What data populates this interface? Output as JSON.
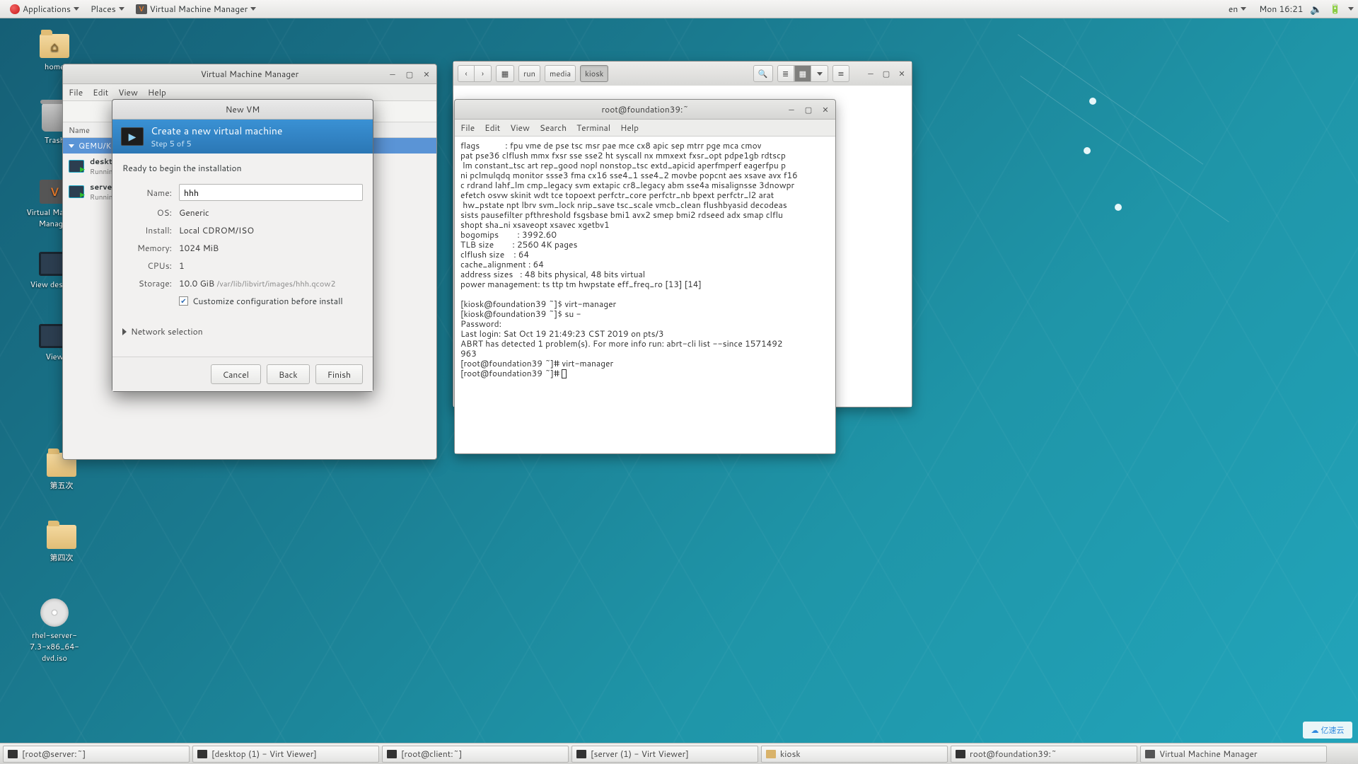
{
  "panel": {
    "applications": "Applications",
    "places": "Places",
    "app_title": "Virtual Machine Manager",
    "lang": "en",
    "clock": "Mon 16:21"
  },
  "desktop_icons": {
    "home": "home",
    "trash": "Trash",
    "vmm": "Virtual Machine Manager",
    "view_desktop": "View desktop",
    "view": "View",
    "folder5": "第五次",
    "folder4": "第四次",
    "iso": "rhel-server-7.3-x86_64-dvd.iso"
  },
  "vmm_window": {
    "title": "Virtual Machine Manager",
    "menu": {
      "file": "File",
      "edit": "Edit",
      "view": "View",
      "help": "Help"
    },
    "header_name": "Name",
    "connection": "QEMU/KVM",
    "vms": [
      {
        "name": "desktop",
        "state": "Running"
      },
      {
        "name": "server",
        "state": "Running"
      }
    ]
  },
  "newvm": {
    "title": "New VM",
    "heading": "Create a new virtual machine",
    "step": "Step 5 of 5",
    "ready": "Ready to begin the installation",
    "labels": {
      "name": "Name:",
      "os": "OS:",
      "install": "Install:",
      "memory": "Memory:",
      "cpus": "CPUs:",
      "storage": "Storage:"
    },
    "values": {
      "name": "hhh",
      "os": "Generic",
      "install": "Local CDROM/ISO",
      "memory": "1024 MiB",
      "cpus": "1",
      "storage": "10.0 GiB",
      "storage_path": "/var/lib/libvirt/images/hhh.qcow2"
    },
    "customize": "Customize configuration before install",
    "network": "Network selection",
    "buttons": {
      "cancel": "Cancel",
      "back": "Back",
      "finish": "Finish"
    }
  },
  "files": {
    "path": {
      "p1": "run",
      "p2": "media",
      "p3": "kiosk"
    }
  },
  "terminal": {
    "title": "root@foundation39:~",
    "menu": {
      "file": "File",
      "edit": "Edit",
      "view": "View",
      "search": "Search",
      "terminal": "Terminal",
      "help": "Help"
    },
    "content": "flags           : fpu vme de pse tsc msr pae mce cx8 apic sep mtrr pge mca cmov\npat pse36 clflush mmx fxsr sse sse2 ht syscall nx mmxext fxsr_opt pdpe1gb rdtscp\n lm constant_tsc art rep_good nopl nonstop_tsc extd_apicid aperfmperf eagerfpu p\nni pclmulqdq monitor ssse3 fma cx16 sse4_1 sse4_2 movbe popcnt aes xsave avx f16\nc rdrand lahf_lm cmp_legacy svm extapic cr8_legacy abm sse4a misalignsse 3dnowpr\nefetch osvw skinit wdt tce topoext perfctr_core perfctr_nb bpext perfctr_l2 arat\n hw_pstate npt lbrv svm_lock nrip_save tsc_scale vmcb_clean flushbyasid decodeas\nsists pausefilter pfthreshold fsgsbase bmi1 avx2 smep bmi2 rdseed adx smap clflu\nshopt sha_ni xsaveopt xsavec xgetbv1\nbogomips        : 3992.60\nTLB size        : 2560 4K pages\nclflush size    : 64\ncache_alignment : 64\naddress sizes   : 48 bits physical, 48 bits virtual\npower management: ts ttp tm hwpstate eff_freq_ro [13] [14]\n\n[kiosk@foundation39 ~]$ virt-manager\n[kiosk@foundation39 ~]$ su -\nPassword:\nLast login: Sat Oct 19 21:49:23 CST 2019 on pts/3\nABRT has detected 1 problem(s). For more info run: abrt-cli list --since 1571492\n963\n[root@foundation39 ~]# virt-manager\n[root@foundation39 ~]# "
  },
  "taskbar": {
    "t1": "[root@server:~]",
    "t2": "[desktop (1) - Virt Viewer]",
    "t3": "[root@client:~]",
    "t4": "[server (1) - Virt Viewer]",
    "t5": "kiosk",
    "t6": "root@foundation39:~",
    "t7": "Virtual Machine Manager"
  },
  "watermark": "亿速云"
}
